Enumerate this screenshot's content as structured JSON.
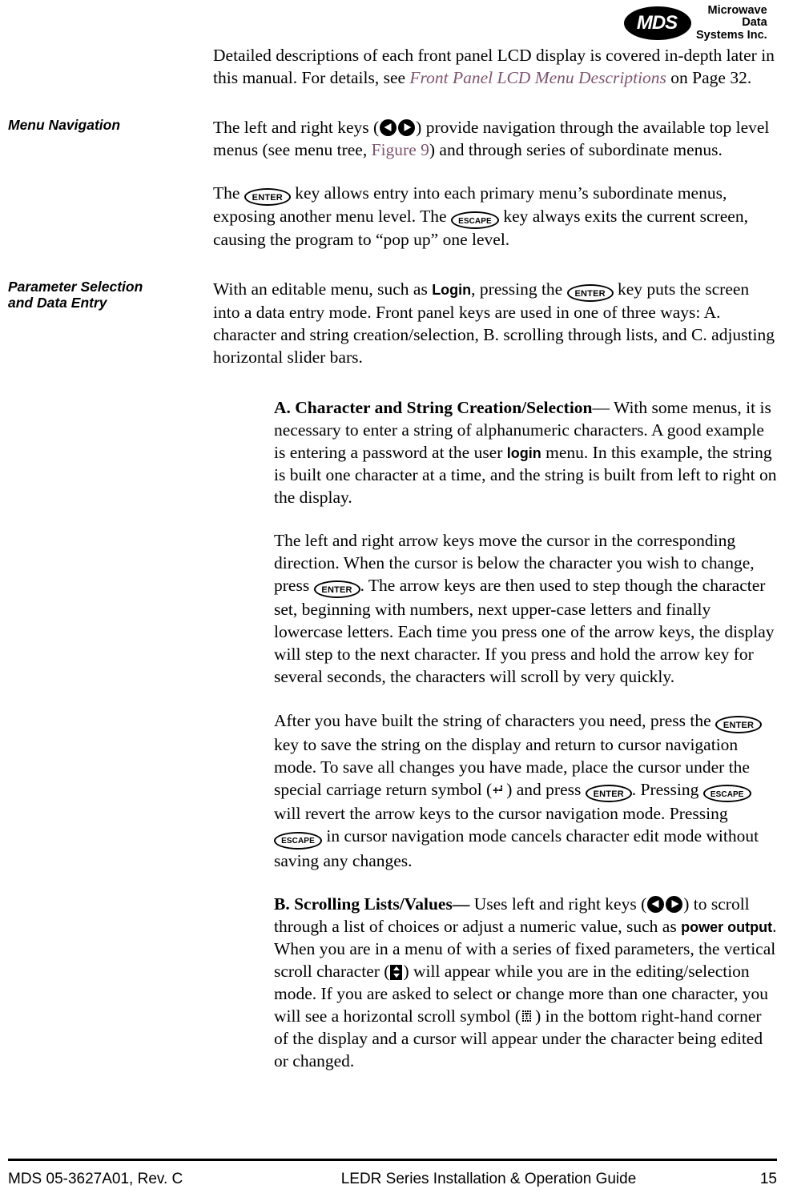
{
  "logo": {
    "mark_text": "MDS",
    "line1": "Microwave",
    "line2": "Data",
    "line3": "Systems Inc."
  },
  "intro": {
    "text_a": "Detailed descriptions of each front panel LCD display is covered in-depth later in this manual. For details, see ",
    "xref_italic": "Front Panel LCD Menu Descriptions",
    "text_b": " on Page 32."
  },
  "menu_navigation": {
    "heading": "Menu Navigation",
    "para1_a": "The left and right keys (",
    "para1_b": ") provide navigation through the available top level menus (see menu tree, ",
    "para1_xref": "Figure 9",
    "para1_c": ") and through series of subordinate menus.",
    "para2_a": "The ",
    "para2_key_enter": "ENTER",
    "para2_b": " key allows entry into each primary menu’s subordinate menus, exposing another menu level. The ",
    "para2_key_escape": "ESCAPE",
    "para2_c": " key always exits the current screen, causing the program to “pop up” one level."
  },
  "parameter_selection": {
    "heading_line1": "Parameter Selection",
    "heading_line2": "and Data Entry",
    "para_a": "With an editable menu, such as ",
    "para_uiname": "Login",
    "para_b": ", pressing the ",
    "para_key_enter": "ENTER",
    "para_c": " key puts the screen into a data entry mode. Front panel keys are used in one of three ways: A. character and string creation/selection, B. scrolling through lists, and C. adjusting horizontal slider bars."
  },
  "section_a": {
    "runin": "A. Character and String Creation/Selection",
    "p1_a": "— With some menus, it is necessary to enter a string of alphanumeric characters. A good example is entering a password at the user ",
    "p1_uiname": "login",
    "p1_b": " menu. In this example, the string is built one character at a time, and the string is built from left to right on the display.",
    "p2_a": "The left and right arrow keys move the cursor in the corresponding direction. When the cursor is below the character you wish to change, press ",
    "p2_key_enter": "ENTER",
    "p2_b": ". The arrow keys are then used to step though the character set, beginning with numbers, next upper-case letters and finally lowercase letters. Each time you press one of the arrow keys, the display will step to the next character. If you press and hold the arrow key for several seconds, the characters will scroll by very quickly.",
    "p3_a": "After you have built the string of characters you need, press the ",
    "p3_key_enter": "ENTER",
    "p3_b": " key to save the string on the display and return to cursor navigation mode. To save all changes you have made, place the cursor under the special carriage return symbol (",
    "p3_c": ") and press ",
    "p3_key_enter2": "ENTER",
    "p3_d": ". Pressing ",
    "p3_key_escape": "ESCAPE",
    "p3_e": " will revert the arrow keys to the cursor navigation mode. Pressing ",
    "p3_key_escape2": "ESCAPE",
    "p3_f": " in cursor navigation mode cancels character edit mode without saving any changes."
  },
  "section_b": {
    "runin": "B. Scrolling Lists/Values—",
    "p1_a": " Uses left and right keys (",
    "p1_b": ") to scroll through a list of choices or adjust a numeric value, such as ",
    "p1_uiname": "power output",
    "p1_c": ". When you are in a menu of with a series of fixed parameters, the vertical scroll character (",
    "p1_d": ") will appear while you are in the editing/selection mode. If you are asked to select or change more than one character, you will see a horizontal scroll symbol (",
    "p1_e": ") in the bottom right-hand corner of the display and a cursor will appear under the character being edited or changed."
  },
  "footer": {
    "left": "MDS 05-3627A01, Rev. C",
    "center": "LEDR Series Installation & Operation Guide",
    "right": "15"
  }
}
